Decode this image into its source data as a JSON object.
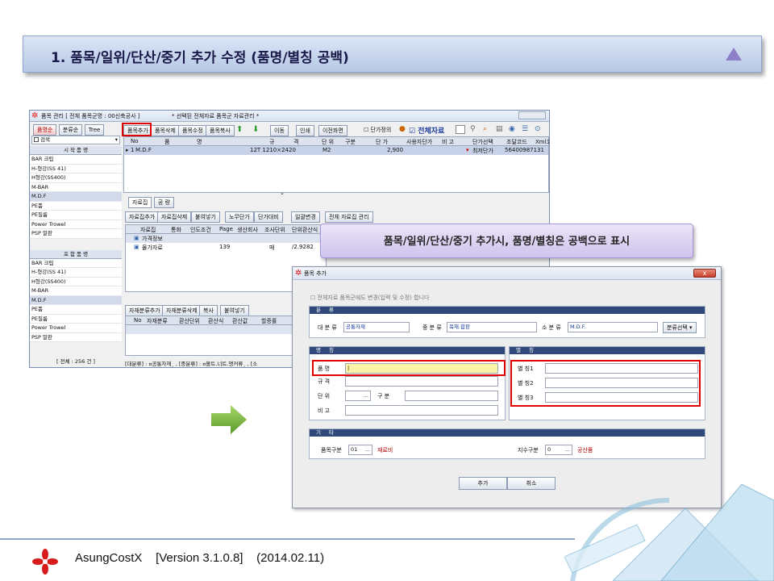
{
  "slide_title": "1. 품목/일위/단산/중기  추가 수정 (품명/별칭 공백)",
  "callout": "품목/일위/단산/중기 추가시, 품명/별칭은 공백으로 표시",
  "footer": {
    "product": "AsungCostX",
    "version": "[Version 3.1.0.8]",
    "date": "(2014.02.11)"
  },
  "main_window": {
    "title": "품목 관리 [ 전체 품목군명 : 00신축공사 ]",
    "title_right": "* 선택된 전체자료 품목군 자료관리 *",
    "left_tabs": [
      "품명순",
      "분류순",
      "Tree"
    ],
    "search_label": "검색",
    "start_header": "시 작 품 명",
    "start_items": [
      "BAR 크립",
      "H-형강(SS 41)",
      "H형강(SS400)",
      "M-BAR",
      "M.D.F",
      "PE폼",
      "PE필름",
      "Power Trowel",
      "PSP 말판"
    ],
    "include_header": "포 함 품 명",
    "include_items": [
      "BAR 크립",
      "H-형강(SS 41)",
      "H형강(SS400)",
      "M-BAR",
      "M.D.F",
      "PE폼",
      "PE필름",
      "Power Trowel",
      "PSP 말판"
    ],
    "total_count": "[ 전체 : 256 건 ]",
    "toolbar": [
      "품목추가",
      "품목삭제",
      "품목수정",
      "품목복사",
      "이동",
      "인쇄",
      "이전화면"
    ],
    "unit_price_check": "단가정의",
    "all_data": "전체자료",
    "grid_headers": [
      "No",
      "품",
      "명",
      "규",
      "격",
      "단 위",
      "구분",
      "단 가",
      "사용자단가",
      "비 고",
      "단가선택",
      "조달코드",
      "Xml코드"
    ],
    "grid_row": {
      "no": "1",
      "name": "M.D.F",
      "spec": "12T  1210×2420",
      "unit": "M2",
      "price": "2,900",
      "price_sel": "최저단가",
      "code": "56400987131"
    },
    "sub_tabs": [
      "자료집",
      "공 량"
    ],
    "sub_toolbar": [
      "자료집추가",
      "자료집삭제",
      "붙여넣기",
      "노무단가",
      "단가대비",
      "일괄변경",
      "전체 자료집 관리"
    ],
    "sub_headers": [
      "자료집",
      "통화",
      "인도조건",
      "Page",
      "생산회사",
      "조사단위",
      "단위환산식"
    ],
    "sub_rows": [
      {
        "name": "가격정보",
        "page": "",
        "unit": "",
        "conv": ""
      },
      {
        "name": "물가자료",
        "page": "139",
        "unit": "매",
        "conv": "/2.9282"
      }
    ],
    "bottom_toolbar": [
      "자재분류추가",
      "자재분류삭제",
      "복사",
      "붙여넣기"
    ],
    "bottom_headers": [
      "No",
      "자재분류",
      "환산단위",
      "환산식",
      "환산값",
      "할증률"
    ],
    "status": "[대분류] : ¤공통자재¸ , [중분류] : ¤볼트.너트.앵커류¸ , [소"
  },
  "dialog": {
    "title": "품목 추가",
    "close": "x",
    "check_all": "전체자료 품목군에도 변경(입력 및 수정) 합니다",
    "class_section": "분 류",
    "big_label": "대 분 류",
    "big_value": "공통자재",
    "mid_label": "중 분 류",
    "mid_value": "목재.합판",
    "small_label": "소 분 류",
    "small_value": "M.D.F.",
    "class_btn": "분류선택",
    "name_section": "명 칭",
    "name_label": "품 명",
    "spec_label": "규 격",
    "unit_label": "단 위",
    "type_label": "구 분",
    "remark_label": "비 고",
    "alias_section": "별 칭",
    "alias1": "별 칭1",
    "alias2": "별 칭2",
    "alias3": "별 칭3",
    "etc_section": "기 타",
    "item_type_label": "품목구분",
    "item_type_code": "01",
    "item_type_value": "재료비",
    "index_type_label": "지수구분",
    "index_type_code": "0",
    "index_type_value": "공산품",
    "ellipsis": "...",
    "add_btn": "추가",
    "cancel_btn": "취소"
  }
}
